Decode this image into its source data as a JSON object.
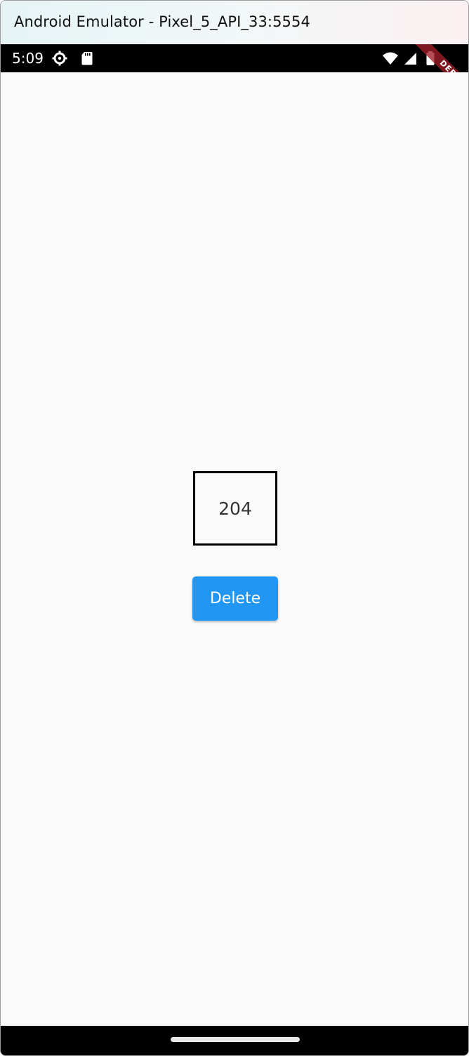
{
  "window": {
    "title": "Android Emulator - Pixel_5_API_33:5554"
  },
  "status_bar": {
    "time": "5:09",
    "left_icons": [
      "settings-gear-icon",
      "sd-card-icon"
    ],
    "right_icons": [
      "wifi-icon",
      "cell-signal-icon",
      "battery-icon"
    ]
  },
  "debug_banner": {
    "label": "DEBUG"
  },
  "main": {
    "counter_value": "204",
    "delete_label": "Delete"
  },
  "colors": {
    "accent": "#2196f3",
    "background": "#fafafa",
    "debug_banner": "#a01e28"
  }
}
